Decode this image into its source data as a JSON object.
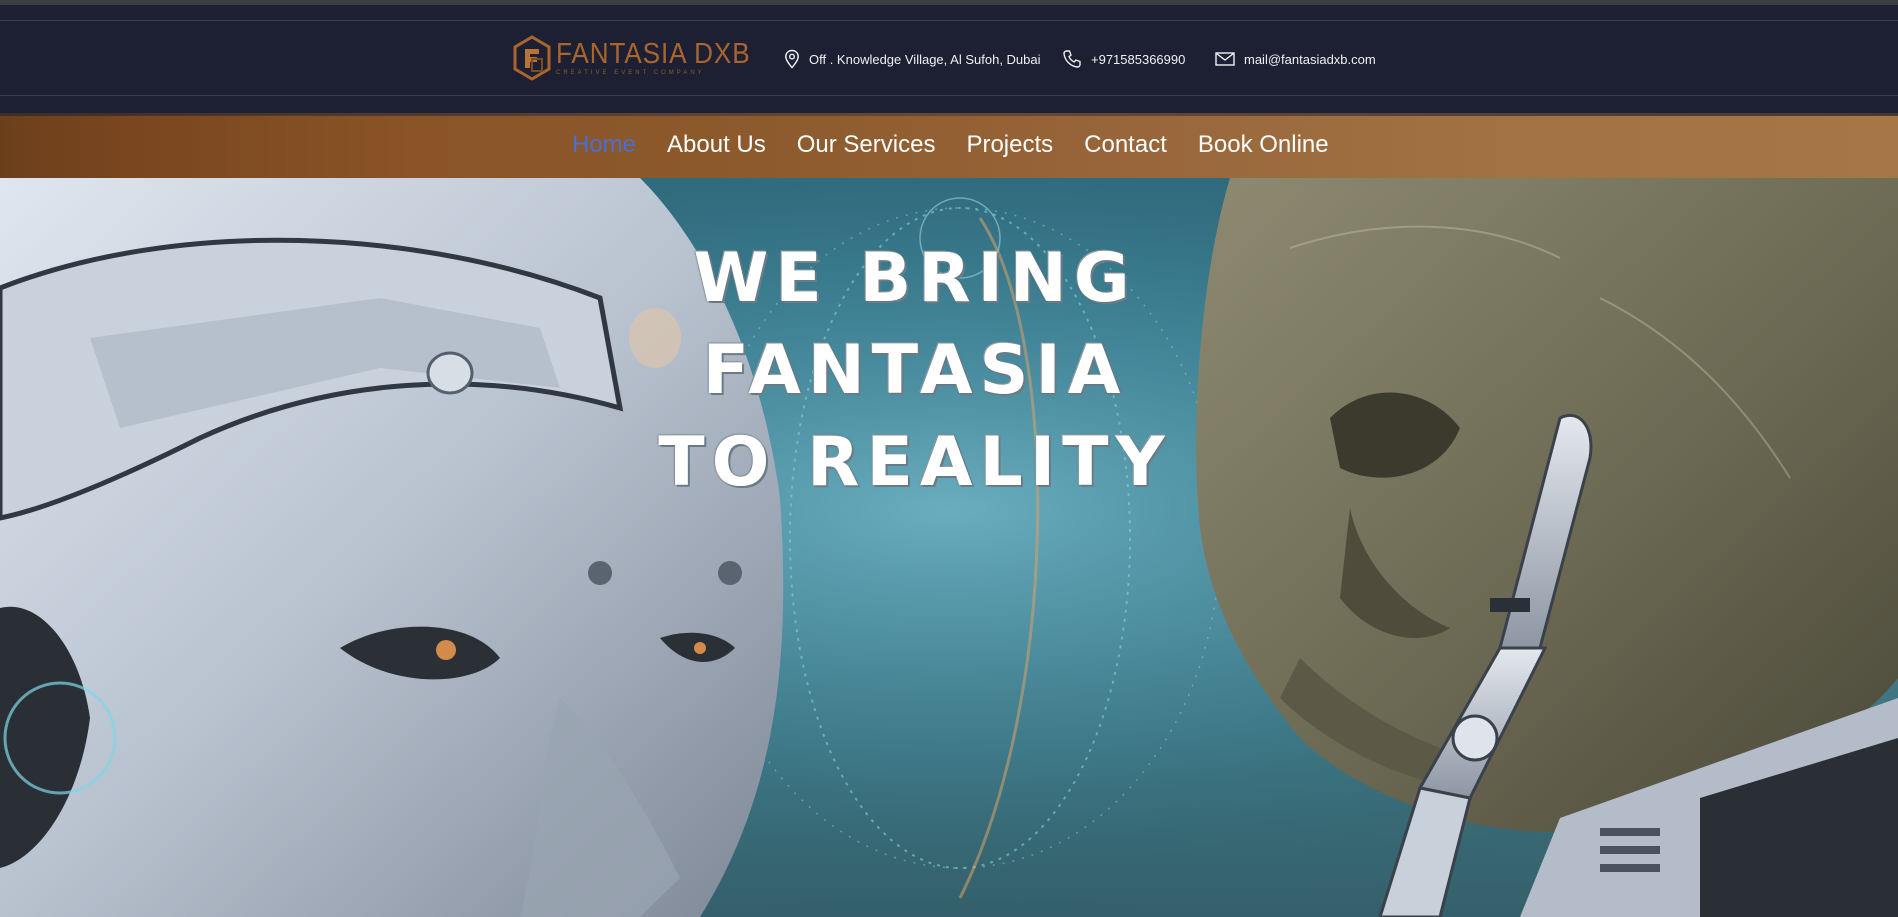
{
  "brand": {
    "name": "FANTASIA DXB",
    "tagline": "CREATIVE EVENT COMPANY",
    "accent": "#a9652d"
  },
  "contact": {
    "address": "Off . Knowledge Village, Al Sufoh, Dubai",
    "phone": "+971585366990",
    "email": "mail@fantasiadxb.com",
    "address_icon": "map-pin-icon",
    "phone_icon": "phone-icon",
    "email_icon": "mail-icon"
  },
  "nav": {
    "items": [
      {
        "label": "Home",
        "active": true
      },
      {
        "label": "About Us",
        "active": false
      },
      {
        "label": "Our Services",
        "active": false
      },
      {
        "label": "Projects",
        "active": false
      },
      {
        "label": "Contact",
        "active": false
      },
      {
        "label": "Book Online",
        "active": false
      }
    ],
    "active_color": "#4a6fd3"
  },
  "hero": {
    "headline_lines": [
      "WE BRING",
      "FANTASIA",
      "TO REALITY"
    ]
  },
  "colors": {
    "infobar_bg": "#1d2033",
    "nav_gradient_start": "#6c3f1c",
    "nav_gradient_end": "#a67646"
  }
}
